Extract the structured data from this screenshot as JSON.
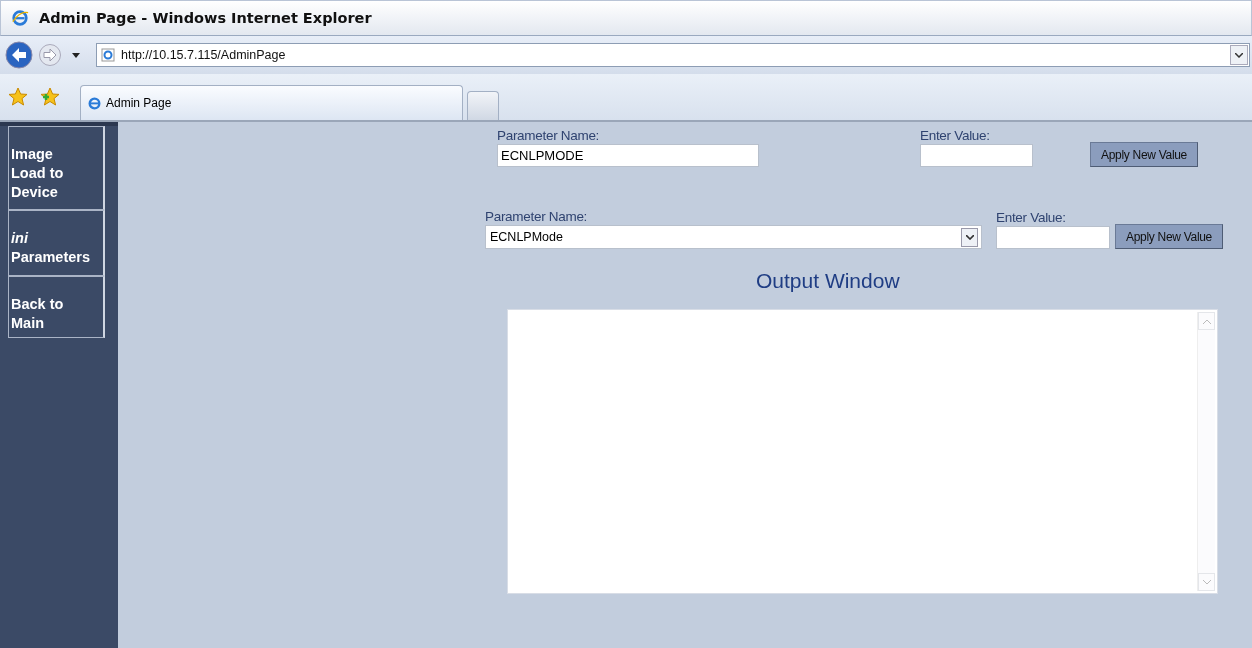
{
  "window": {
    "title": "Admin Page - Windows Internet Explorer"
  },
  "address_bar": {
    "url": "http://10.15.7.115/AdminPage"
  },
  "tabs": [
    {
      "label": "Admin Page",
      "selected": true
    }
  ],
  "sidebar": {
    "items": [
      {
        "label": "Image Load to Device"
      },
      {
        "label": "*ini* Parameters"
      },
      {
        "label": "Back to Main"
      }
    ]
  },
  "form_1": {
    "name_label": "Parameter Name:",
    "name_value": "ECNLPMODE",
    "value_label": "Enter Value:",
    "button": "Apply New Value"
  },
  "form_2": {
    "name_label": "Parameter Name:",
    "name_value": "ECNLPMode",
    "value_label": "Enter Value:",
    "button": "Apply New Value"
  },
  "output": {
    "title": "Output Window"
  }
}
